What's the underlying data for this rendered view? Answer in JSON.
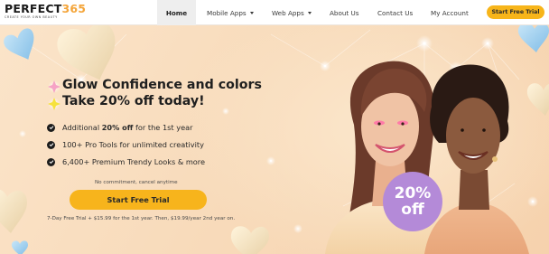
{
  "brand": {
    "name_text": "PERFECT",
    "name_number": "365",
    "tagline": "CREATE YOUR OWN BEAUTY"
  },
  "nav": {
    "items": [
      {
        "label": "Home",
        "active": true
      },
      {
        "label": "Mobile Apps",
        "dropdown": true
      },
      {
        "label": "Web Apps",
        "dropdown": true
      },
      {
        "label": "About Us"
      },
      {
        "label": "Contact Us"
      },
      {
        "label": "My Account"
      }
    ],
    "cta_label": "Start Free Trial"
  },
  "hero": {
    "headline_1": "Glow Confidence and colors",
    "headline_2": "Take 20% off today!",
    "features": [
      {
        "text_before": "Additional ",
        "highlight": "20% off",
        "text_after": " for the 1st year"
      },
      {
        "text_before": "100+ Pro Tools for unlimited creativity",
        "highlight": "",
        "text_after": ""
      },
      {
        "text_before": "6,400+ Premium Trendy Looks & more",
        "highlight": "",
        "text_after": ""
      }
    ],
    "no_commitment": "No commitment, cancel anytime",
    "cta_label": "Start Free Trial",
    "pricing_note": "7-Day Free Trial + $15.99 for the 1st year. Then, $19.99/year 2nd year on.",
    "badge": {
      "value": "20%",
      "suffix": "off"
    }
  },
  "colors": {
    "accent": "#f7b41c",
    "badge": "#b48ad8",
    "background": "#f9e3c7",
    "text": "#1f1f1f"
  },
  "icons": [
    "check-circle-icon",
    "pink-star-icon",
    "yellow-star-icon",
    "chevron-down-icon",
    "heart-decoration-icon"
  ]
}
